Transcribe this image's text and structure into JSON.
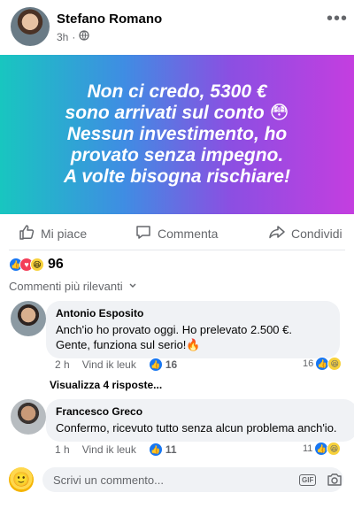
{
  "post": {
    "author": "Stefano Romano",
    "time": "3h",
    "dot": "·",
    "banner_lines": [
      "Non ci credo, 5300 €",
      "sono arrivati sul conto 😳",
      "Nessun investimento, ho",
      "provato senza impegno.",
      "A volte bisogna rischiare!"
    ]
  },
  "actions": {
    "like": "Mi piace",
    "comment": "Commenta",
    "share": "Condividi"
  },
  "reactions": {
    "count": "96",
    "types": [
      "like-icon",
      "love-icon",
      "haha-icon"
    ]
  },
  "filter": {
    "label": "Commenti più rilevanti"
  },
  "comments": [
    {
      "author": "Antonio Esposito",
      "lines": [
        "Anch'io ho provato oggi. Ho prelevato 2.500 €.",
        "Gente, funziona sul serio!🔥"
      ],
      "time": "2 h",
      "like_label": "Vind ik leuk",
      "likes": "16",
      "reactions_count": "16",
      "replies_label": "Visualizza 4 risposte..."
    },
    {
      "author": "Francesco Greco",
      "lines": [
        "Confermo, ricevuto tutto senza alcun problema anch'io."
      ],
      "time": "1 h",
      "like_label": "Vind ik leuk",
      "likes": "11",
      "reactions_count": "11"
    }
  ],
  "composer": {
    "placeholder": "Scrivi un commento...",
    "gif_label": "GIF"
  },
  "colors": {
    "brand_blue": "#1877f2",
    "text_secondary": "#65676b",
    "bubble": "#f0f2f5"
  }
}
